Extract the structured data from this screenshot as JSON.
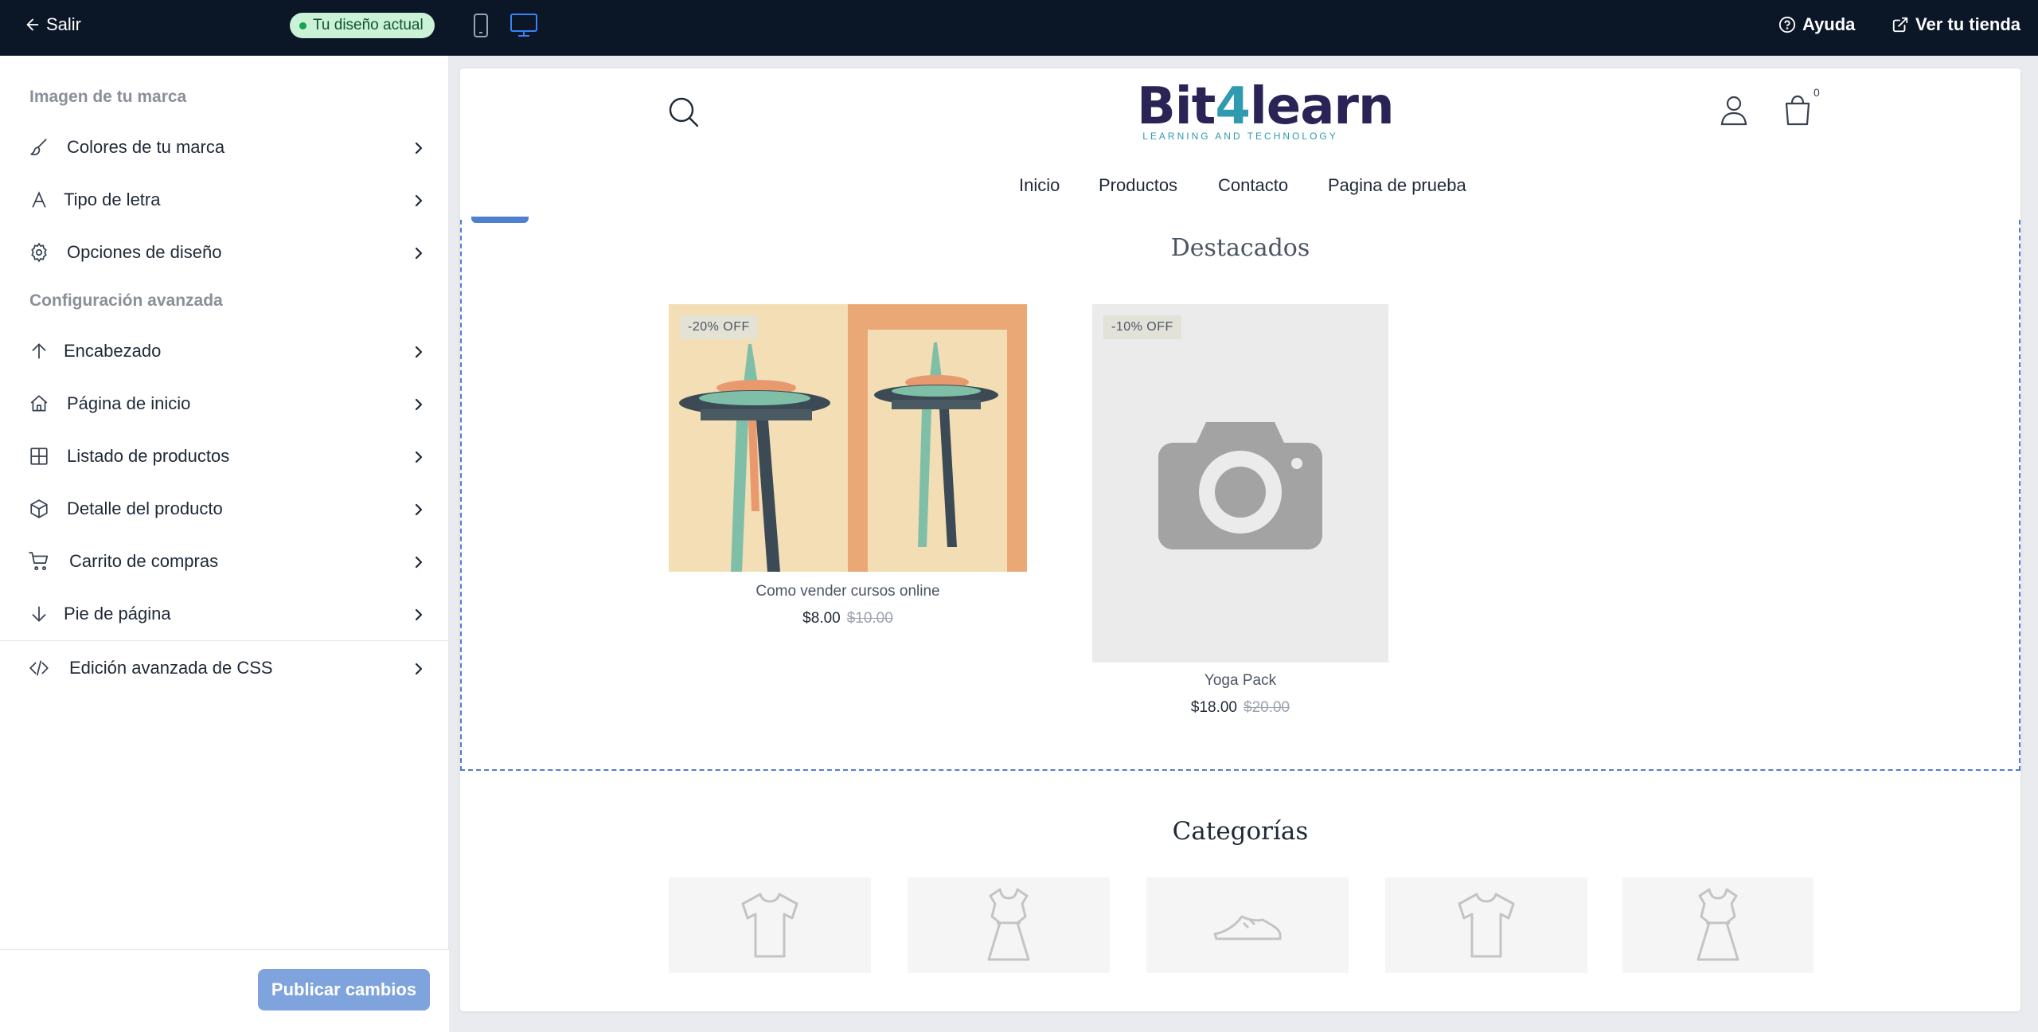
{
  "topbar": {
    "back_label": "Salir",
    "current_design_label": "Tu diseño actual",
    "help_label": "Ayuda",
    "store_label": "Ver tu tienda"
  },
  "sidebar": {
    "section_brand": "Imagen de tu marca",
    "section_advanced": "Configuración avanzada",
    "items": [
      {
        "label": "Colores de tu marca",
        "icon": "brush-icon"
      },
      {
        "label": "Tipo de letra",
        "icon": "font-icon"
      },
      {
        "label": "Opciones de diseño",
        "icon": "gear-icon"
      },
      {
        "label": "Encabezado",
        "icon": "arrow-up-icon"
      },
      {
        "label": "Página de inicio",
        "icon": "home-icon"
      },
      {
        "label": "Listado de productos",
        "icon": "grid-icon"
      },
      {
        "label": "Detalle del producto",
        "icon": "box-icon"
      },
      {
        "label": "Carrito de compras",
        "icon": "cart-icon"
      },
      {
        "label": "Pie de página",
        "icon": "arrow-down-icon"
      },
      {
        "label": "Edición avanzada de CSS",
        "icon": "code-icon"
      }
    ],
    "publish_label": "Publicar cambios"
  },
  "store": {
    "logo_main_a": "Bit",
    "logo_main_b": "4",
    "logo_main_c": "learn",
    "logo_sub": "LEARNING AND TECHNOLOGY",
    "cart_count": "0",
    "nav": [
      "Inicio",
      "Productos",
      "Contacto",
      "Pagina de prueba"
    ],
    "featured_title": "Destacados",
    "products": [
      {
        "badge": "-20% OFF",
        "name": "Como vender cursos online",
        "price": "$8.00",
        "old_price": "$10.00"
      },
      {
        "badge": "-10% OFF",
        "name": "Yoga Pack",
        "price": "$18.00",
        "old_price": "$20.00"
      }
    ],
    "categories_title": "Categorías",
    "categories": [
      "tshirt-icon",
      "dress-icon",
      "sneaker-icon",
      "tshirt-icon",
      "dress-icon"
    ]
  },
  "colors": {
    "topbar_bg": "#0b1727",
    "accent": "#4f7fcf",
    "publish_bg": "#7fa3dd",
    "badge_bg": "#c9f2d6"
  }
}
